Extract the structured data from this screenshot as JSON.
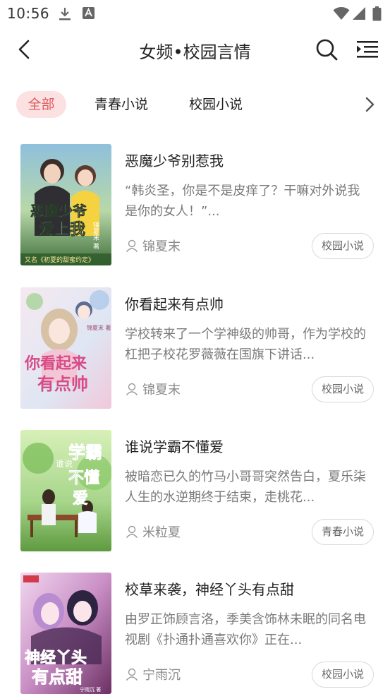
{
  "status_bar": {
    "time": "10:56",
    "icons": [
      "download-icon",
      "app-notification-icon",
      "wifi-icon",
      "signal-icon",
      "battery-icon"
    ]
  },
  "header": {
    "title": "女频•校园言情",
    "back_icon": "chevron-left-icon",
    "search_icon": "search-icon",
    "menu_icon": "list-menu-icon"
  },
  "tabs": [
    {
      "label": "全部",
      "active": true
    },
    {
      "label": "青春小说",
      "active": false
    },
    {
      "label": "校园小说",
      "active": false
    }
  ],
  "tabs_more_icon": "chevron-right-icon",
  "books": [
    {
      "title": "恶魔少爷别惹我",
      "description": "“韩炎圣，你是不是皮痒了？干嘛对外说我是你的女人！”...",
      "author": "锦夏末",
      "category": "校园小说",
      "cover": {
        "text": "恶魔少爷爱上我",
        "author": "锦夏末 著",
        "subtitle": "又名《初夏的甜蜜约定》",
        "colors": [
          "#6fa6c9",
          "#3c6b3a"
        ]
      }
    },
    {
      "title": "你看起来有点帅",
      "description": "学校转来了一个学神级的帅哥，作为学校的杠把子校花罗薇薇在国旗下讲话...",
      "author": "锦夏末",
      "category": "校园小说",
      "cover": {
        "text": "你看起来有点帅",
        "author": "锦夏末 著",
        "colors": [
          "#f4e3ec",
          "#c9d6ea"
        ]
      }
    },
    {
      "title": "谁说学霸不懂爱",
      "description": "被暗恋已久的竹马小哥哥突然告白，夏乐柒人生的水逆期终于结束，走桃花...",
      "author": "米粒夏",
      "category": "青春小说",
      "cover": {
        "text": "谁说学霸不懂爱",
        "colors": [
          "#bfe6a0",
          "#6aa34a"
        ]
      }
    },
    {
      "title": "校草来袭，神经丫头有点甜",
      "description": "由罗正饰顾言洛，季美含饰林未眠的同名电视剧《扑通扑通喜欢你》正在...",
      "author": "宁雨沉",
      "category": "校园小说",
      "cover": {
        "text": "神经丫头有点甜",
        "author": "宁雨沉 著",
        "colors": [
          "#e7c6e8",
          "#8a3f7d"
        ]
      }
    }
  ]
}
